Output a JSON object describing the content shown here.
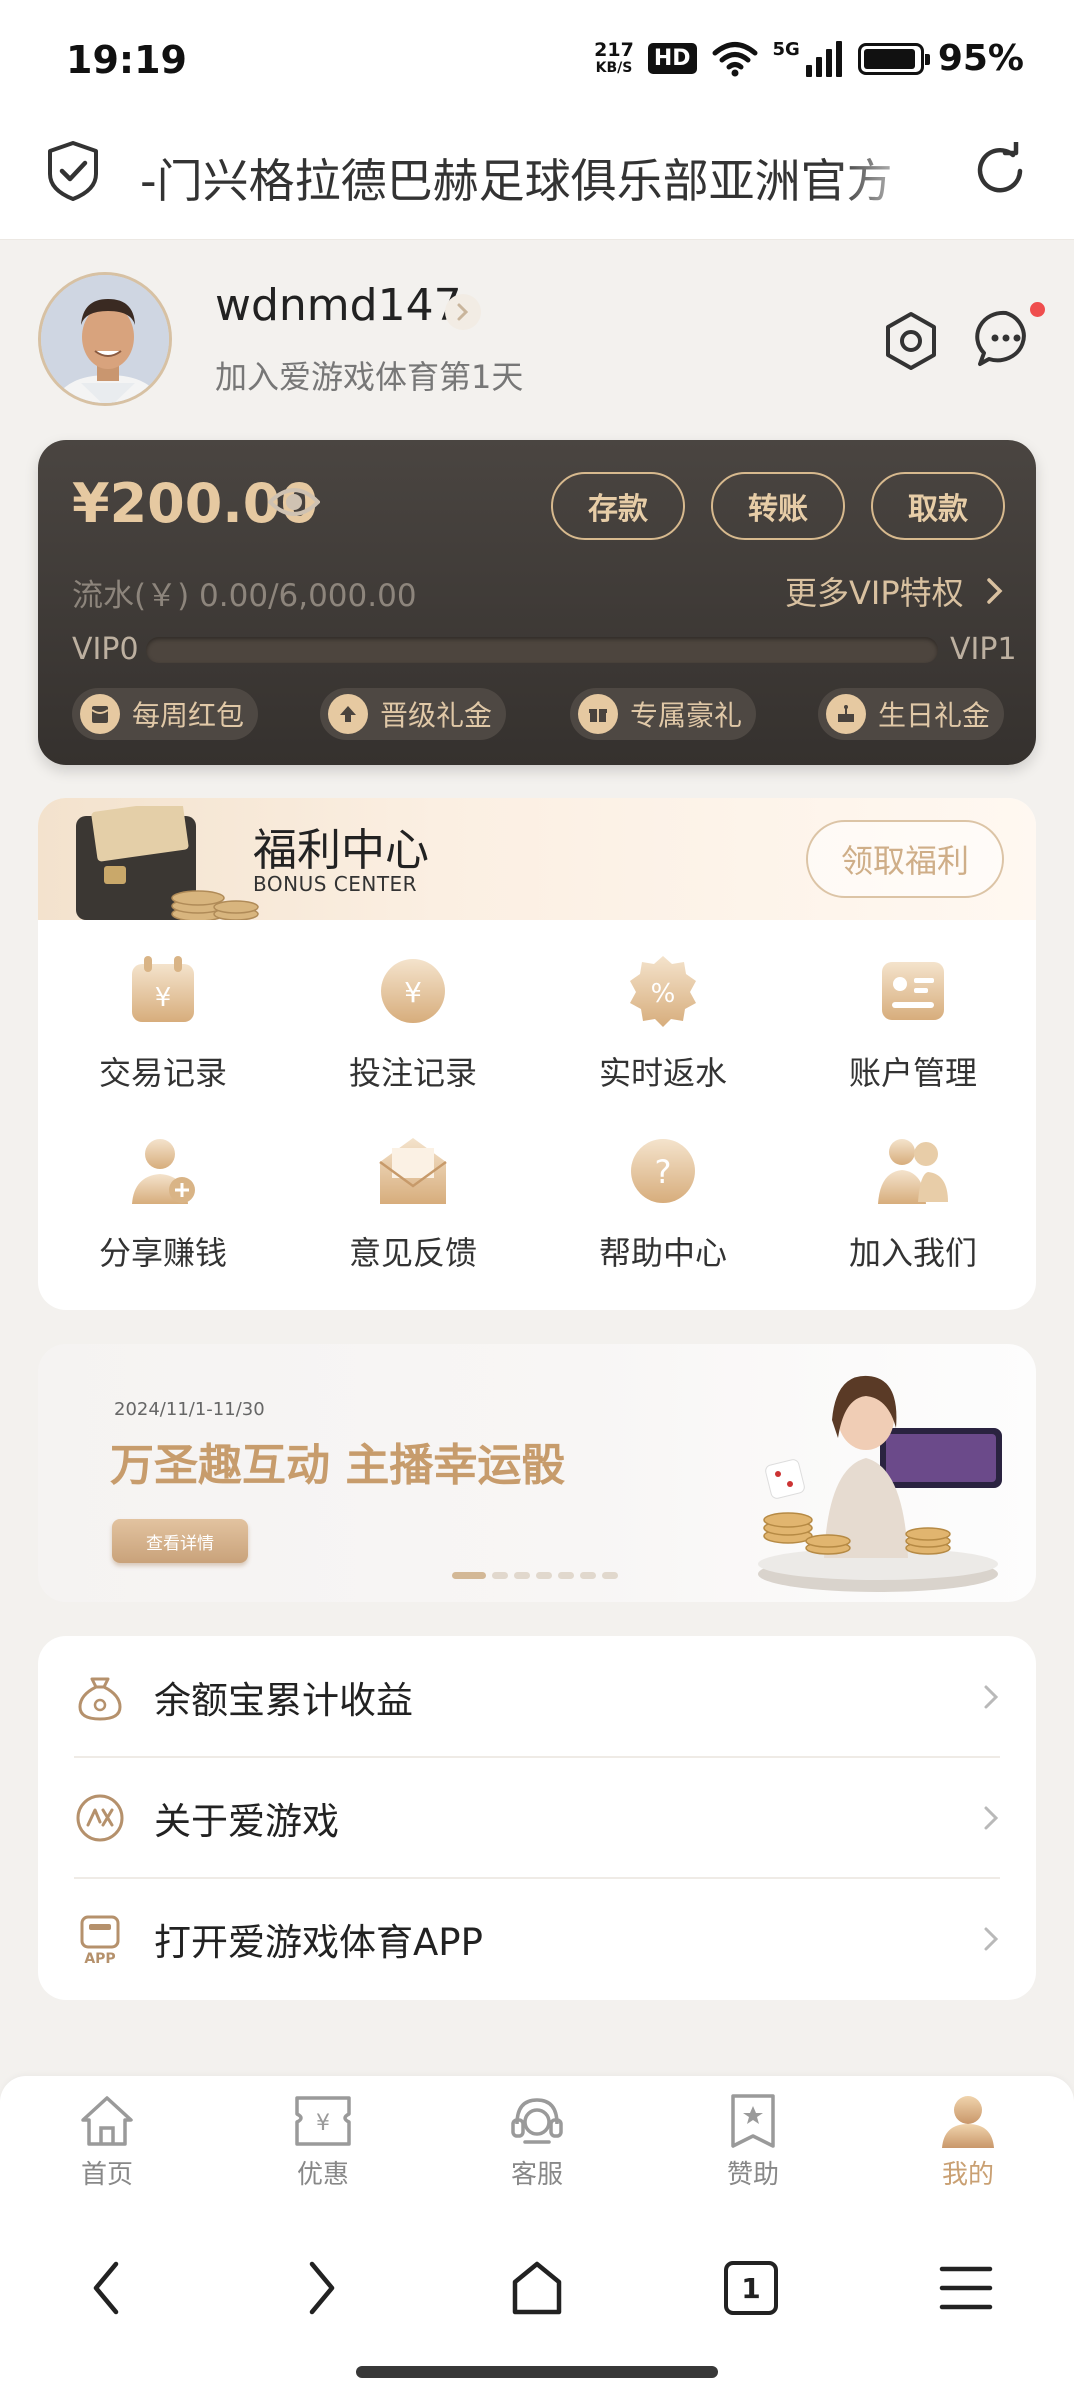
{
  "status_bar": {
    "time": "19:19",
    "speed_value": "217",
    "speed_unit": "KB/S",
    "hd": "HD",
    "network": "5G",
    "battery": "95%"
  },
  "address_bar": {
    "url_text": "-门兴格拉德巴赫足球俱乐部亚洲官方"
  },
  "profile": {
    "username": "wdnmd147",
    "subtitle": "加入爱游戏体育第1天"
  },
  "wallet": {
    "balance": "¥200.00",
    "deposit": "存款",
    "transfer": "转账",
    "withdraw": "取款",
    "flow_label": "流水(￥) 0.00/6,000.00",
    "vip_more": "更多VIP特权",
    "vip_current": "VIP0",
    "vip_next": "VIP1",
    "vip_progress": 0,
    "perks": [
      "每周红包",
      "晋级礼金",
      "专属豪礼",
      "生日礼金"
    ]
  },
  "bonus_center": {
    "title": "福利中心",
    "subtitle": "BONUS CENTER",
    "claim": "领取福利",
    "items": [
      {
        "label": "交易记录",
        "icon": "transaction-record-icon"
      },
      {
        "label": "投注记录",
        "icon": "bet-record-icon"
      },
      {
        "label": "实时返水",
        "icon": "rebate-icon"
      },
      {
        "label": "账户管理",
        "icon": "account-icon"
      },
      {
        "label": "分享赚钱",
        "icon": "share-icon"
      },
      {
        "label": "意见反馈",
        "icon": "feedback-icon"
      },
      {
        "label": "帮助中心",
        "icon": "help-icon"
      },
      {
        "label": "加入我们",
        "icon": "join-icon"
      }
    ]
  },
  "banner": {
    "date": "2024/11/1-11/30",
    "title": "万圣趣互动 主播幸运骰",
    "button": "查看详情",
    "active_slide": 0,
    "slide_count": 7
  },
  "menu": [
    {
      "label": "余额宝累计收益",
      "icon": "money-bag-icon"
    },
    {
      "label": "关于爱游戏",
      "icon": "brand-logo-icon"
    },
    {
      "label": "打开爱游戏体育APP",
      "icon": "app-icon"
    }
  ],
  "tabs": [
    {
      "label": "首页",
      "icon": "home-icon"
    },
    {
      "label": "优惠",
      "icon": "coupon-icon"
    },
    {
      "label": "客服",
      "icon": "headset-icon"
    },
    {
      "label": "赞助",
      "icon": "sponsor-icon"
    },
    {
      "label": "我的",
      "icon": "user-icon"
    }
  ],
  "active_tab": 4,
  "browser_nav": {
    "tab_count": "1"
  },
  "colors": {
    "accent_gold": "#c9a073",
    "card_dark": "#3e3a36",
    "badge_red": "#ef4e4e"
  }
}
